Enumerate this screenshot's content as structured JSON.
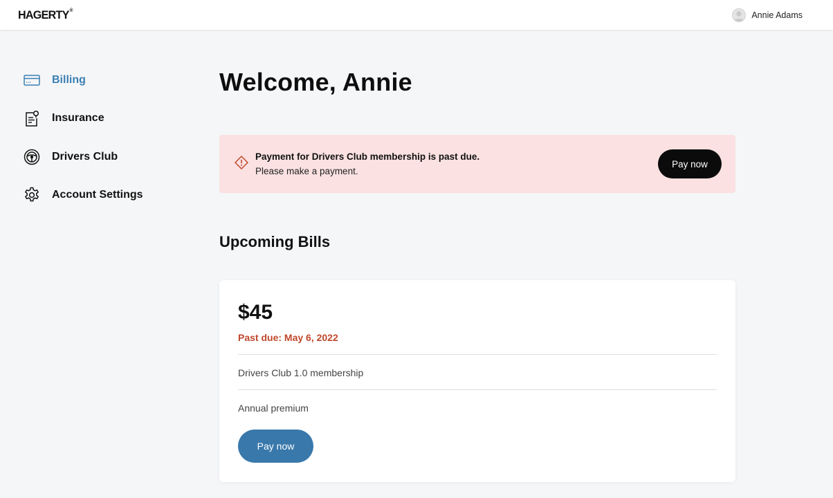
{
  "header": {
    "logo": "HAGERTY",
    "logo_mark": "®",
    "user_name": "Annie Adams"
  },
  "sidebar": {
    "items": [
      {
        "label": "Billing",
        "icon": "credit-card-icon",
        "active": true
      },
      {
        "label": "Insurance",
        "icon": "document-badge-icon",
        "active": false
      },
      {
        "label": "Drivers Club",
        "icon": "steering-wheel-icon",
        "active": false
      },
      {
        "label": "Account Settings",
        "icon": "gear-icon",
        "active": false
      }
    ]
  },
  "main": {
    "welcome": "Welcome, Annie",
    "alert": {
      "title": "Payment for Drivers Club membership is past due.",
      "subtitle": "Please make a payment.",
      "button": "Pay now",
      "icon": "warning-diamond-icon"
    },
    "upcoming_title": "Upcoming Bills",
    "bill": {
      "amount": "$45",
      "due": "Past due: May 6, 2022",
      "description": "Drivers Club 1.0 membership",
      "term": "Annual premium",
      "button": "Pay now"
    }
  },
  "colors": {
    "accent": "#3a7fb3",
    "alert_bg": "#fbe1e1",
    "due_red": "#c0472b",
    "pay_blue": "#3978ab"
  }
}
